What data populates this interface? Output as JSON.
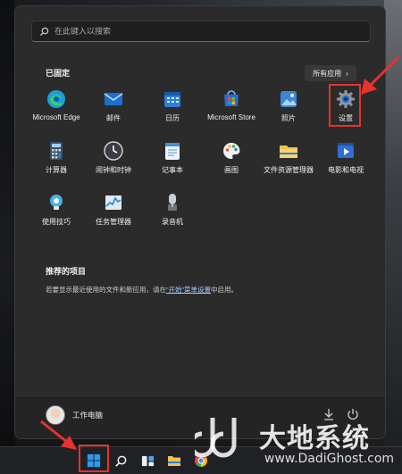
{
  "start_menu": {
    "search": {
      "placeholder": "在此键入以搜索",
      "icon": "search-icon"
    },
    "pinned": {
      "title": "已固定",
      "all_apps_label": "所有应用",
      "apps": [
        {
          "label": "Microsoft Edge",
          "icon": "edge-icon",
          "color": "#1f8ad4"
        },
        {
          "label": "邮件",
          "icon": "mail-icon",
          "color": "#2a78d6"
        },
        {
          "label": "日历",
          "icon": "calendar-icon",
          "color": "#2f7dd6"
        },
        {
          "label": "Microsoft Store",
          "icon": "store-icon",
          "color": "#3d7fd8"
        },
        {
          "label": "照片",
          "icon": "photos-icon",
          "color": "#3b86d9"
        },
        {
          "label": "设置",
          "icon": "gear-icon",
          "color": "#8a8f98"
        },
        {
          "label": "计算器",
          "icon": "calculator-icon",
          "color": "#4a6b8a"
        },
        {
          "label": "闹钟和时钟",
          "icon": "clock-icon",
          "color": "#c8c8c8"
        },
        {
          "label": "记事本",
          "icon": "notepad-icon",
          "color": "#3f8fe0"
        },
        {
          "label": "画图",
          "icon": "paint-icon",
          "color": "#e9a53b"
        },
        {
          "label": "文件资源管理器",
          "icon": "folder-icon",
          "color": "#f2c14e"
        },
        {
          "label": "电影和电视",
          "icon": "movies-icon",
          "color": "#2f6fd0"
        },
        {
          "label": "使用技巧",
          "icon": "tips-icon",
          "color": "#4ab0ea"
        },
        {
          "label": "任务管理器",
          "icon": "task-manager-icon",
          "color": "#8bb3d9"
        },
        {
          "label": "录音机",
          "icon": "recorder-icon",
          "color": "#9aa0a8"
        }
      ]
    },
    "recommended": {
      "title": "推荐的项目",
      "desc_before": "若要显示最近使用的文件和新应用，请在",
      "desc_link": "“开始”菜单设置",
      "desc_after": "中启用。"
    },
    "footer": {
      "username": "工作电脑",
      "download_icon": "download-icon",
      "power_icon": "power-icon"
    }
  },
  "taskbar": {
    "items": [
      "start-icon",
      "search-icon",
      "task-view-icon",
      "file-explorer-icon",
      "chrome-icon"
    ]
  },
  "watermark": {
    "text": "大地系统",
    "url": "www.DadiGhost.com"
  },
  "colors": {
    "highlight": "#e8322e",
    "accent": "#0078d4"
  }
}
